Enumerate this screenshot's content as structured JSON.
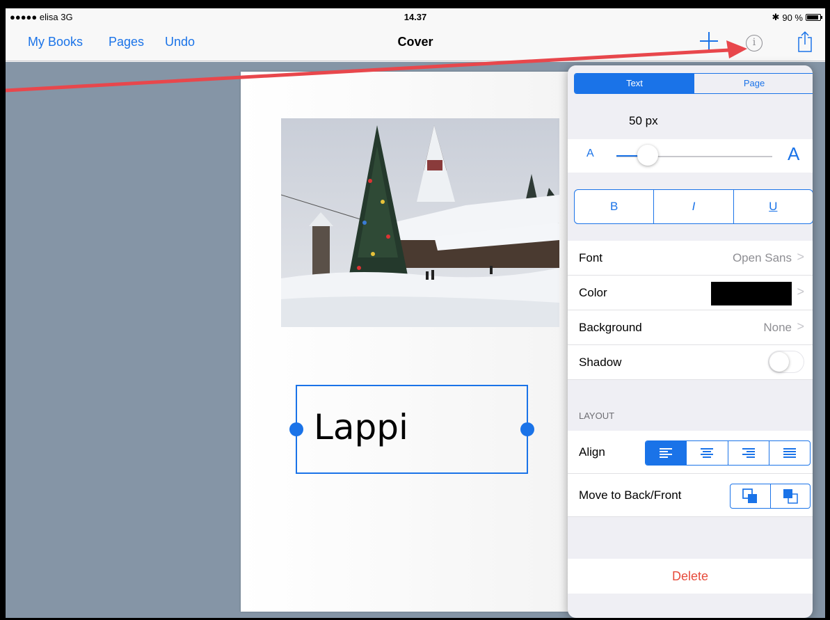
{
  "status_bar": {
    "carrier": "●●●●● elisa  3G",
    "time": "14.37",
    "bluetooth": "✱",
    "battery_text": "90 %"
  },
  "nav": {
    "left_buttons": [
      "My Books",
      "Pages",
      "Undo"
    ],
    "title": "Cover",
    "info_glyph": "i",
    "icons": [
      "plus-icon",
      "info-icon",
      "share-icon"
    ]
  },
  "page": {
    "text_content": "Lappi"
  },
  "inspector": {
    "tabs": [
      {
        "label": "Text",
        "active": true
      },
      {
        "label": "Page",
        "active": false
      }
    ],
    "size_label": "50 px",
    "slider": {
      "small_label": "A",
      "large_label": "A",
      "value_fraction": 0.2
    },
    "style_buttons": [
      "B",
      "I",
      "U"
    ],
    "rows": {
      "font": {
        "label": "Font",
        "value": "Open Sans",
        "chevron": ">"
      },
      "color": {
        "label": "Color",
        "swatch": "#000000",
        "chevron": ">"
      },
      "background": {
        "label": "Background",
        "value": "None",
        "chevron": ">"
      },
      "shadow": {
        "label": "Shadow",
        "on": false
      }
    },
    "layout_header": "LAYOUT",
    "align": {
      "label": "Align",
      "options": [
        "align-left-icon",
        "align-center-icon",
        "align-right-icon",
        "align-justify-icon"
      ],
      "selected": 0
    },
    "order": {
      "label": "Move to Back/Front",
      "options": [
        "send-to-back-icon",
        "bring-to-front-icon"
      ]
    },
    "delete_label": "Delete"
  },
  "colors": {
    "accent": "#1a73e8",
    "destructive": "#e74c3c",
    "workspace": "#8595a6",
    "annotation_arrow": "#e8474c"
  }
}
